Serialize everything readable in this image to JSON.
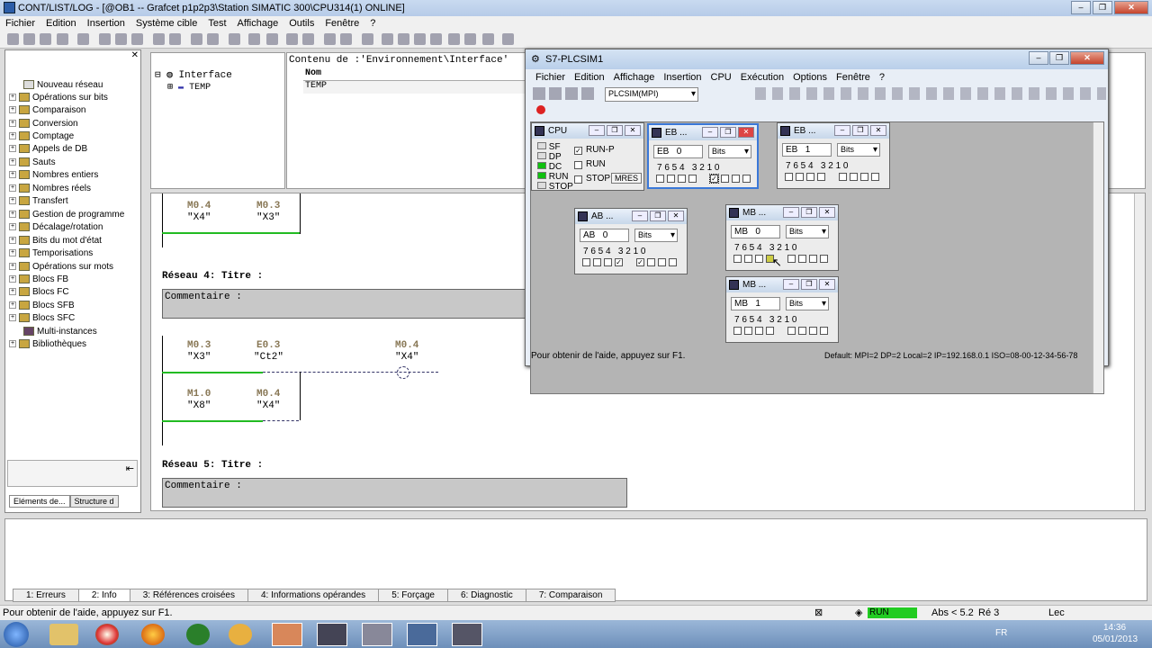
{
  "window": {
    "title": "CONT/LIST/LOG - [@OB1 -- Grafcet p1p2p3\\Station SIMATIC 300\\CPU314(1)  ONLINE]",
    "buttons": [
      "–",
      "❐",
      "✕"
    ]
  },
  "menu": [
    "Fichier",
    "Edition",
    "Insertion",
    "Système cible",
    "Test",
    "Affichage",
    "Outils",
    "Fenêtre",
    "?"
  ],
  "tree": [
    "Nouveau réseau",
    "Opérations sur bits",
    "Comparaison",
    "Conversion",
    "Comptage",
    "Appels de DB",
    "Sauts",
    "Nombres entiers",
    "Nombres réels",
    "Transfert",
    "Gestion de programme",
    "Décalage/rotation",
    "Bits du mot d'état",
    "Temporisations",
    "Opérations sur mots",
    "Blocs FB",
    "Blocs FC",
    "Blocs SFB",
    "Blocs SFC",
    "Multi-instances",
    "Bibliothèques"
  ],
  "left_tabs": [
    "Eléments de...",
    "Structure d"
  ],
  "iface": {
    "root": "Interface",
    "child": "TEMP",
    "header": "Contenu de :'Environnement\\Interface'",
    "col_name": "Nom",
    "row": "TEMP"
  },
  "ladder": {
    "n3": {
      "c1_addr": "M0.4",
      "c1_sym": "\"X4\"",
      "c2_addr": "M0.3",
      "c2_sym": "\"X3\""
    },
    "n4": {
      "label": "Réseau",
      "num": "4",
      "titre": ": Titre :",
      "comment": "Commentaire :",
      "c1_addr": "M0.3",
      "c1_sym": "\"X3\"",
      "c2_addr": "E0.3",
      "c2_sym": "\"Ct2\"",
      "coil_addr": "M0.4",
      "coil_sym": "\"X4\"",
      "c3_addr": "M1.0",
      "c3_sym": "\"X8\"",
      "c4_addr": "M0.4",
      "c4_sym": "\"X4\""
    },
    "n5": {
      "label": "Réseau",
      "num": "5",
      "titre": ": Titre :",
      "comment": "Commentaire :"
    }
  },
  "bottom_tabs": [
    "1: Erreurs",
    "2: Info",
    "3: Références croisées",
    "4: Informations opérandes",
    "5: Forçage",
    "6: Diagnostic",
    "7: Comparaison"
  ],
  "status": {
    "help": "Pour obtenir de l'aide, appuyez sur F1.",
    "run": "RUN",
    "abs": "Abs < 5.2",
    "re": "Ré 3",
    "lec": "Lec"
  },
  "taskbar": {
    "lang": "FR",
    "time": "14:36",
    "date": "05/01/2013"
  },
  "sim": {
    "title": "S7-PLCSIM1",
    "menu": [
      "Fichier",
      "Edition",
      "Affichage",
      "Insertion",
      "CPU",
      "Exécution",
      "Options",
      "Fenêtre",
      "?"
    ],
    "combo": "PLCSIM(MPI)",
    "status": "Pour obtenir de l'aide, appuyez sur F1.",
    "status_right": "Default:  MPI=2 DP=2 Local=2 IP=192.168.0.1 ISO=08-00-12-34-56-78",
    "cpu": {
      "title": "CPU",
      "leds": [
        "SF",
        "DP",
        "DC",
        "RUN",
        "STOP"
      ],
      "opt1": "RUN-P",
      "opt2": "RUN",
      "opt3": "STOP",
      "mres": "MRES"
    },
    "eb0": {
      "title": "EB ...",
      "type": "EB",
      "num": "0",
      "fmt": "Bits"
    },
    "eb1": {
      "title": "EB ...",
      "type": "EB",
      "num": "1",
      "fmt": "Bits"
    },
    "ab0": {
      "title": "AB ...",
      "type": "AB",
      "num": "0",
      "fmt": "Bits"
    },
    "mb0": {
      "title": "MB ...",
      "type": "MB",
      "num": "0",
      "fmt": "Bits"
    },
    "mb1": {
      "title": "MB ...",
      "type": "MB",
      "num": "1",
      "fmt": "Bits"
    },
    "bitlabels": "7 6 5 4   3 2 1 0"
  },
  "colors": {
    "ladder_green": "#22bb22",
    "led_green": "#10c010"
  }
}
